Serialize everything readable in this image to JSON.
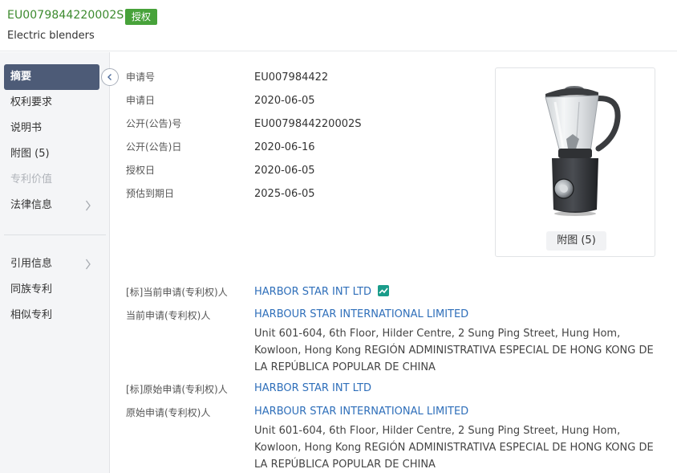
{
  "header": {
    "publication_number": "EU0079844220002S",
    "status": "授权",
    "title": "Electric blenders"
  },
  "sidebar": {
    "items": [
      {
        "label": "摘要"
      },
      {
        "label": "权利要求"
      },
      {
        "label": "说明书"
      },
      {
        "label": "附图 (5)"
      },
      {
        "label": "专利价值"
      },
      {
        "label": "法律信息"
      }
    ],
    "items2": [
      {
        "label": "引用信息"
      },
      {
        "label": "同族专利"
      },
      {
        "label": "相似专利"
      }
    ]
  },
  "info": [
    {
      "label": "申请号",
      "value": "EU007984422"
    },
    {
      "label": "申请日",
      "value": "2020-06-05"
    },
    {
      "label": "公开(公告)号",
      "value": "EU0079844220002S"
    },
    {
      "label": "公开(公告)日",
      "value": "2020-06-16"
    },
    {
      "label": "授权日",
      "value": "2020-06-05"
    },
    {
      "label": "预估到期日",
      "value": "2025-06-05"
    }
  ],
  "image_card": {
    "button_label": "附图 (5)"
  },
  "applicants": [
    {
      "label": "[标]当前申请(专利权)人",
      "name": "HARBOR STAR INT LTD"
    },
    {
      "label": "当前申请(专利权)人",
      "name": "HARBOUR STAR INTERNATIONAL LIMITED",
      "address_lines": [
        "Unit 601-604, 6th Floor, Hilder Centre, 2 Sung Ping Street, Hung Hom,",
        "Kowloon, Hong Kong REGIÓN ADMINISTRATIVA ESPECIAL DE HONG KONG DE",
        "LA REPÚBLICA POPULAR DE CHINA"
      ]
    },
    {
      "label": "[标]原始申请(专利权)人",
      "name": "HARBOR STAR INT LTD"
    },
    {
      "label": "原始申请(专利权)人",
      "name": "HARBOUR STAR INTERNATIONAL LIMITED",
      "address_lines": [
        "Unit 601-604, 6th Floor, Hilder Centre, 2 Sung Ping Street, Hung Hom,",
        "Kowloon, Hong Kong REGIÓN ADMINISTRATIVA ESPECIAL DE HONG KONG DE",
        "LA REPÚBLICA POPULAR DE CHINA"
      ]
    }
  ],
  "colors": {
    "accent_green": "#3c8a2e",
    "badge_green": "#47a23a",
    "link_blue": "#2f6fba",
    "sidebar_active": "#4d5b77"
  }
}
